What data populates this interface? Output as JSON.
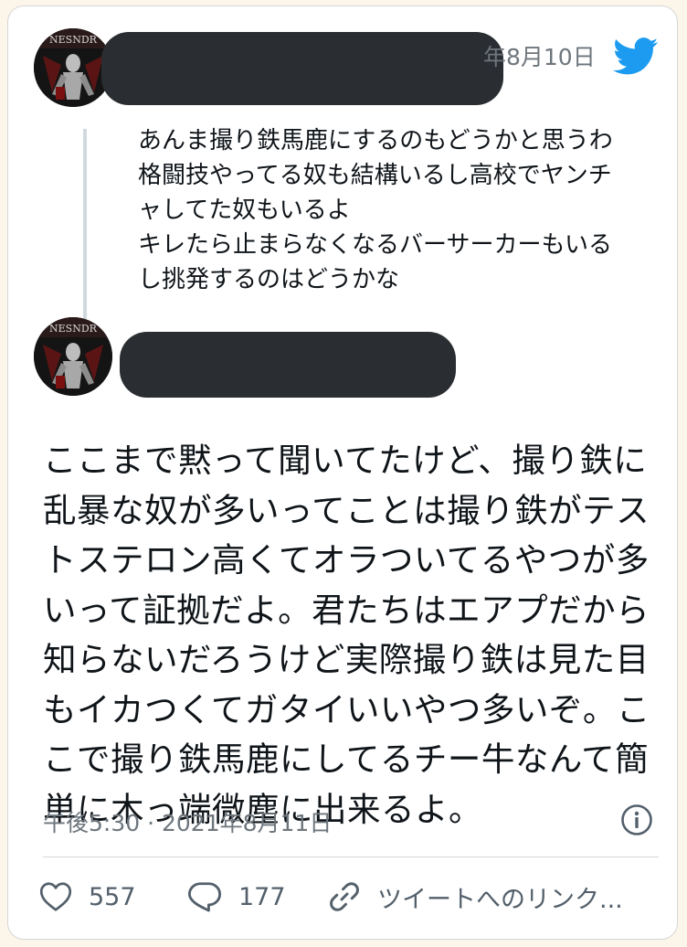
{
  "parent_tweet": {
    "date": "年8月10日",
    "lines": [
      "あんま撮り鉄馬鹿にするのもどうかと思うわ",
      "格闘技やってる奴も結構いるし高校でヤンチ",
      "ャしてた奴もいるよ",
      "キレたら止まらなくなるバーサーカーもいる",
      "し挑発するのはどうかな"
    ]
  },
  "main_tweet": {
    "lines": [
      "ここまで黙って聞いてたけど、撮り鉄に",
      "乱暴な奴が多いってことは撮り鉄がテス",
      "トステロン高くてオラついてるやつが多",
      "いって証拠だよ。君たちはエアプだから",
      "知らないだろうけど実際撮り鉄は見た目",
      "もイカつくてガタイいいやつ多いぞ。こ",
      "こで撮り鉄馬鹿にしてるチー牛なんて簡",
      "単に木っ端微塵に出来るよ。"
    ],
    "timestamp": "午後5:30 · 2021年8月11日"
  },
  "actions": {
    "likes": "557",
    "replies": "177",
    "link_label": "ツイートへのリンク..."
  },
  "icons": {
    "bird": "twitter-bird-icon",
    "info": "info-icon",
    "like": "heart-icon",
    "reply": "reply-bubble-icon",
    "link": "link-icon"
  },
  "colors": {
    "twitter_blue": "#1d9bf0",
    "text": "#0f1419",
    "secondary": "#6e767d",
    "redaction": "#2a2d31"
  }
}
